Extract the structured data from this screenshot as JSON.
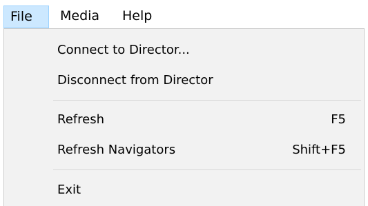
{
  "menubar": {
    "items": [
      {
        "label": "File"
      },
      {
        "label": "Media"
      },
      {
        "label": "Help"
      }
    ]
  },
  "file_menu": {
    "items": [
      {
        "label": "Connect to Director...",
        "shortcut": ""
      },
      {
        "label": "Disconnect from Director",
        "shortcut": ""
      },
      {
        "label": "Refresh",
        "shortcut": "F5"
      },
      {
        "label": "Refresh Navigators",
        "shortcut": "Shift+F5"
      },
      {
        "label": "Exit",
        "shortcut": ""
      }
    ]
  },
  "colors": {
    "active_menu_bg": "#cce8ff",
    "active_menu_border": "#99d1ff",
    "dropdown_bg": "#f2f2f2",
    "separator": "#d7d7d7"
  }
}
